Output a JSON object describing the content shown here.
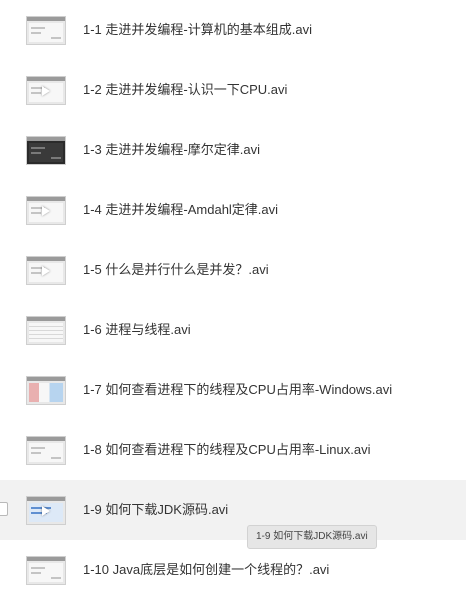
{
  "files": [
    {
      "name": "1-1 走进并发编程-计算机的基本组成.avi",
      "thumb_icon": "video-file-icon"
    },
    {
      "name": "1-2 走进并发编程-认识一下CPU.avi",
      "thumb_icon": "video-file-icon"
    },
    {
      "name": "1-3 走进并发编程-摩尔定律.avi",
      "thumb_icon": "video-file-icon"
    },
    {
      "name": "1-4 走进并发编程-Amdahl定律.avi",
      "thumb_icon": "video-file-icon"
    },
    {
      "name": "1-5 什么是并行什么是并发？.avi",
      "thumb_icon": "video-file-icon"
    },
    {
      "name": "1-6 进程与线程.avi",
      "thumb_icon": "video-file-icon"
    },
    {
      "name": "1-7 如何查看进程下的线程及CPU占用率-Windows.avi",
      "thumb_icon": "video-file-icon"
    },
    {
      "name": "1-8 如何查看进程下的线程及CPU占用率-Linux.avi",
      "thumb_icon": "video-file-icon"
    },
    {
      "name": "1-9 如何下载JDK源码.avi",
      "thumb_icon": "video-file-icon"
    },
    {
      "name": "1-10 Java底层是如何创建一个线程的？.avi",
      "thumb_icon": "video-file-icon"
    }
  ],
  "tooltip": {
    "text": "1-9 如何下载JDK源码.avi"
  },
  "colors": {
    "hover_row": "#f2f2f2",
    "text": "#333333",
    "tooltip_bg": "#e6e6e6"
  }
}
